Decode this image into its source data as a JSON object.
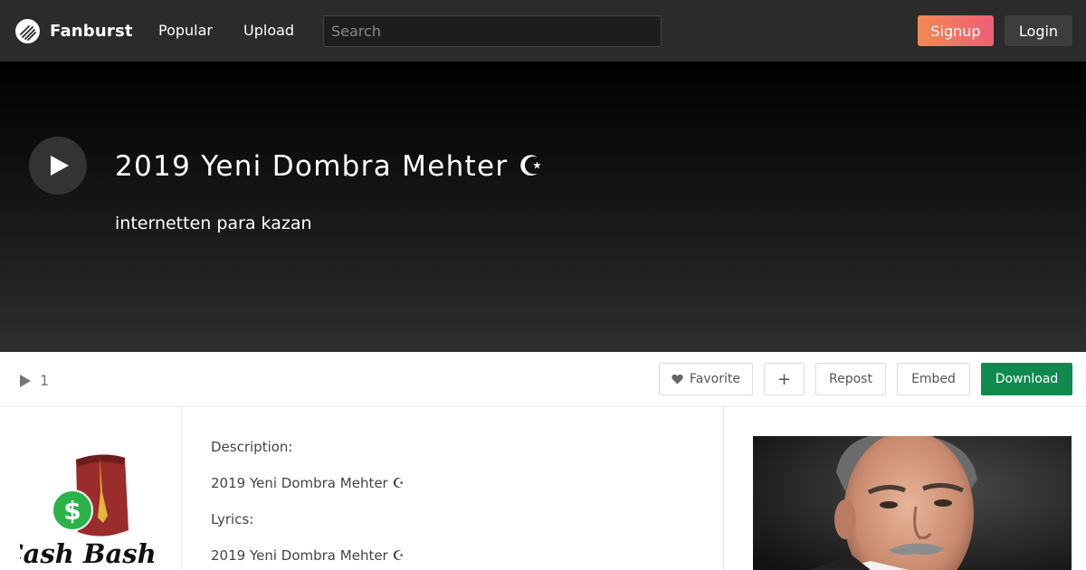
{
  "header": {
    "brand": "Fanburst",
    "nav": [
      "Popular",
      "Upload"
    ],
    "search_placeholder": "Search",
    "signup_label": "Signup",
    "login_label": "Login"
  },
  "hero": {
    "title": "2019 Yeni Dombra Mehter ☪",
    "artist": "internetten para kazan"
  },
  "actions": {
    "play_count": "1",
    "favorite_label": "Favorite",
    "add_label": "+",
    "repost_label": "Repost",
    "embed_label": "Embed",
    "download_label": "Download"
  },
  "details": {
    "description_label": "Description:",
    "description_text": "2019 Yeni Dombra Mehter ☪",
    "lyrics_label": "Lyrics:",
    "lyrics_text": "2019 Yeni Dombra Mehter ☪"
  },
  "avatar_logo_text": "Cash Basha",
  "colors": {
    "header_bg": "#2b2b2b",
    "signup_gradient_start": "#f28a55",
    "signup_gradient_end": "#ef5e76",
    "download_bg": "#0f8a4f"
  }
}
